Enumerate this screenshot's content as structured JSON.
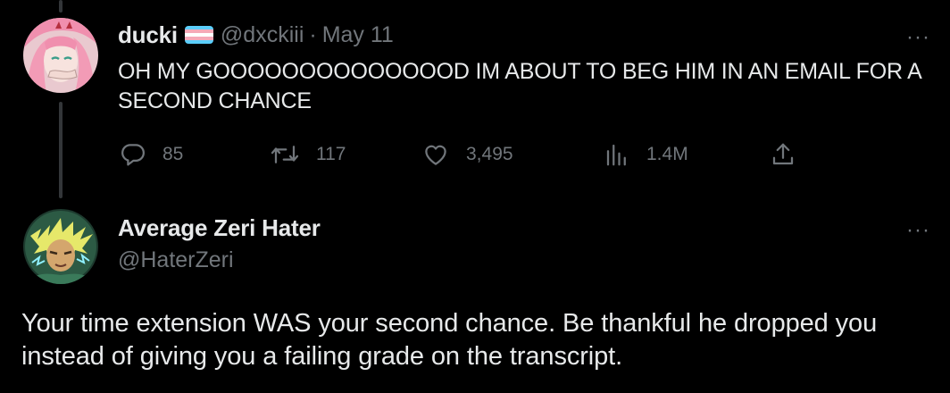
{
  "tweet": {
    "author_name": "ducki",
    "handle": "@dxckiii",
    "separator": "·",
    "date": "May 11",
    "text": "OH MY GOOOOOOOOOOOOOOD IM ABOUT TO BEG HIM IN AN EMAIL FOR A SECOND CHANCE",
    "more_label": "···",
    "flag_icon": "trans-flag-emoji",
    "flag_colors": [
      "#5BCEFA",
      "#F5A9B8",
      "#FFFFFF",
      "#F5A9B8",
      "#5BCEFA"
    ],
    "actions": {
      "replies": "85",
      "retweets": "117",
      "likes": "3,495",
      "views": "1.4M"
    }
  },
  "reply": {
    "author_name": "Average Zeri Hater",
    "handle": "@HaterZeri",
    "more_label": "···",
    "text": "Your time extension WAS your second chance. Be thankful he dropped you instead of giving you a failing grade on the transcript."
  },
  "colors": {
    "background": "#000000",
    "text": "#e7e9ea",
    "muted": "#71767b",
    "thread_line": "#333639"
  }
}
